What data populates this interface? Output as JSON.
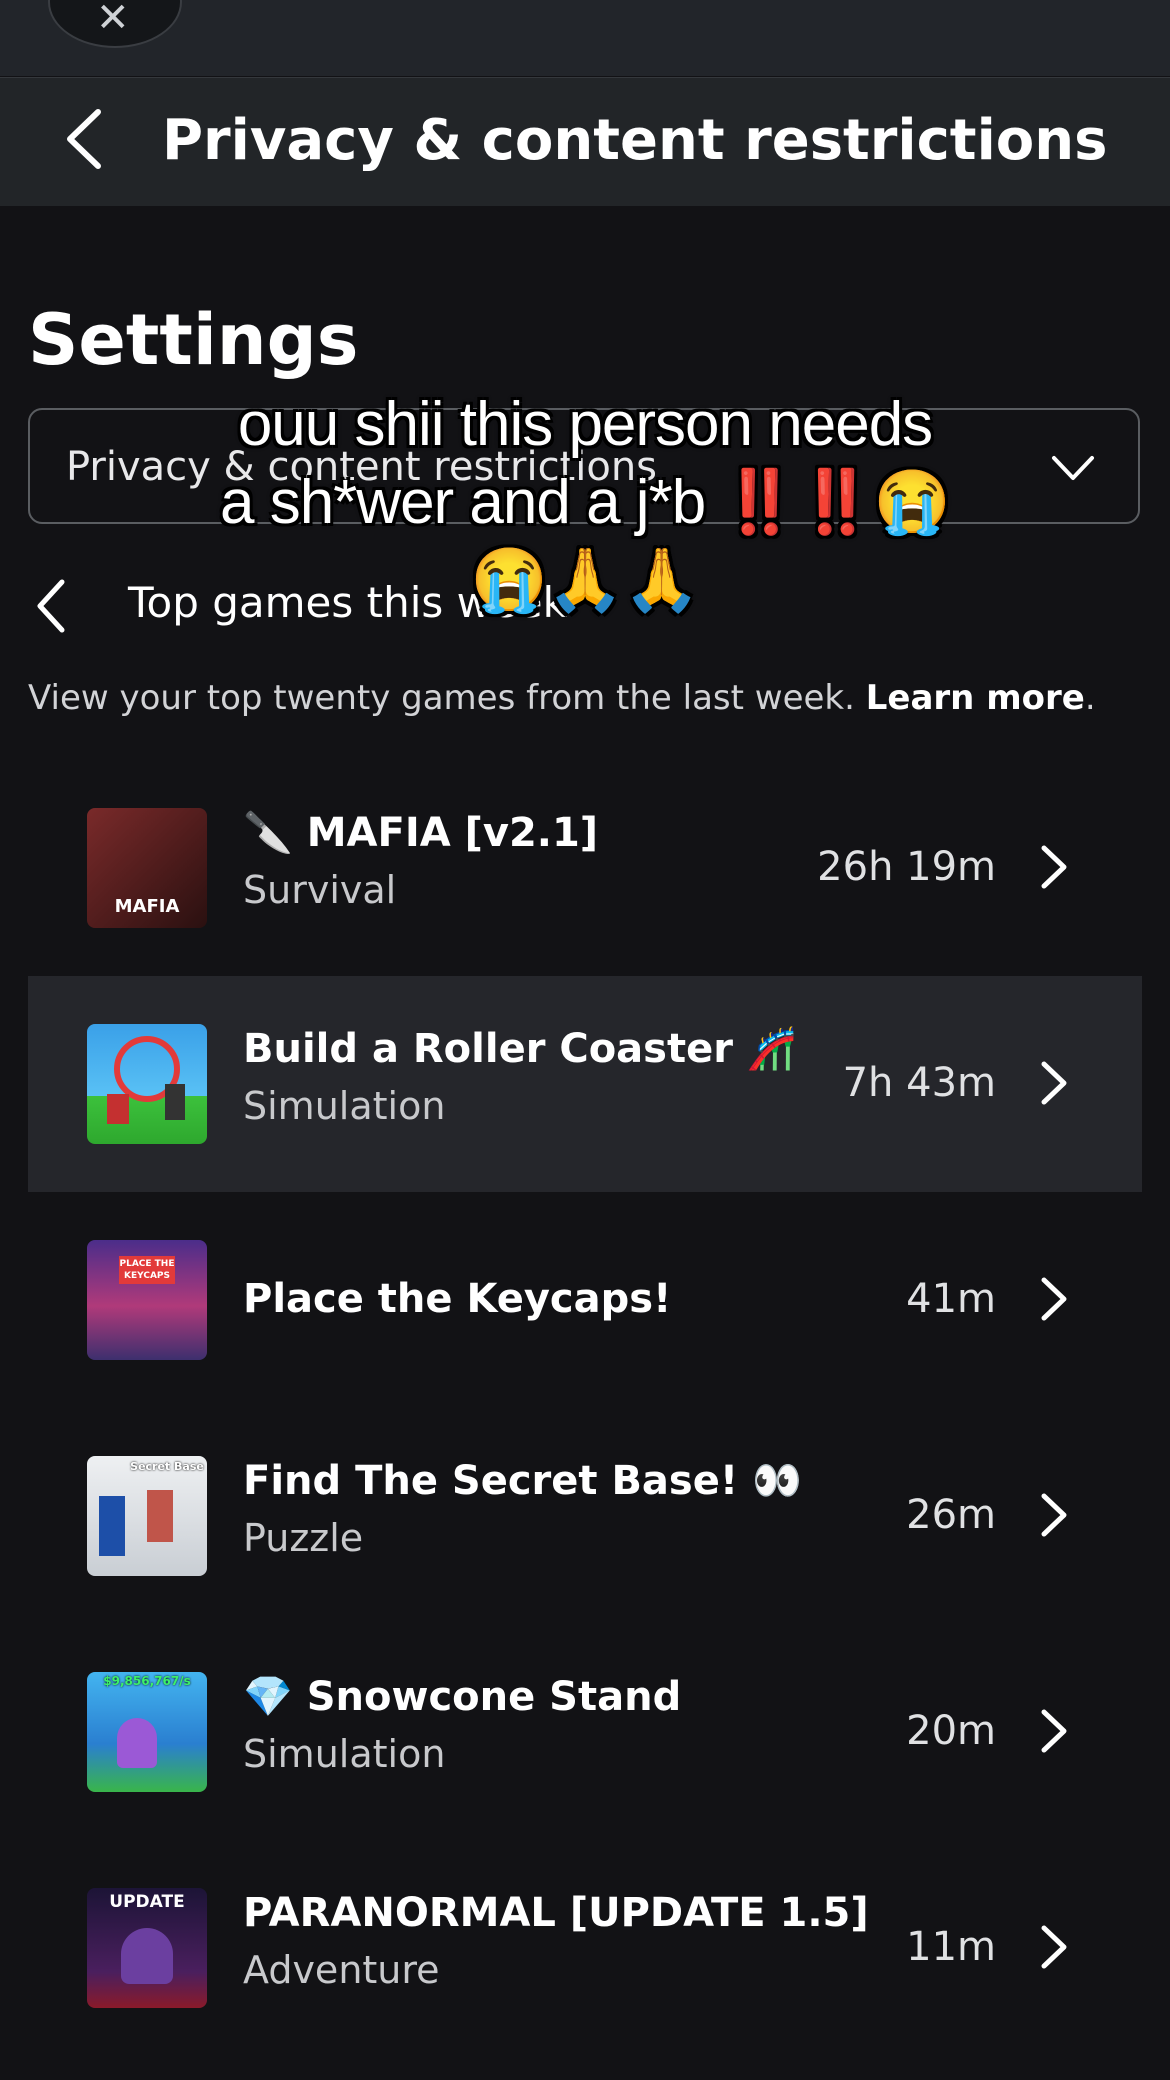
{
  "header": {
    "title": "Privacy & content restrictions"
  },
  "settings": {
    "title": "Settings",
    "dropdown_value": "Privacy & content restrictions"
  },
  "section": {
    "title": "Top games this week",
    "description": "View your top twenty games from the last week. ",
    "learn_more": "Learn more",
    "period": "."
  },
  "overlay": {
    "line1": "ouu shii this person needs",
    "line2": "a sh*wer and a j*b ‼️‼️😭",
    "line3": "😭🙏🙏"
  },
  "games": [
    {
      "title": "🔪 MAFIA [v2.1]",
      "genre": "Survival",
      "time": "26h 19m",
      "thumb_label": "MAFIA",
      "thumb_color": "#5a1e1e"
    },
    {
      "title": "Build a Roller Coaster 🎢",
      "genre": "Simulation",
      "time": "7h 43m",
      "thumb_label": "",
      "thumb_color": "#3aa0e8"
    },
    {
      "title": "Place the Keycaps!",
      "genre": "",
      "time": "41m",
      "thumb_label": "PLACE THE KEYCAPS",
      "thumb_color": "#6a3fb5"
    },
    {
      "title": "Find The Secret Base! 👀",
      "genre": "Puzzle",
      "time": "26m",
      "thumb_label": "Secret Base",
      "thumb_color": "#d9dde2"
    },
    {
      "title": "💎 Snowcone Stand",
      "genre": "Simulation",
      "time": "20m",
      "thumb_label": "$9,856,767/s",
      "thumb_color": "#2f9be0"
    },
    {
      "title": "PARANORMAL [UPDATE 1.5]",
      "genre": "Adventure",
      "time": "11m",
      "thumb_label": "UPDATE",
      "thumb_color": "#24183f"
    }
  ]
}
